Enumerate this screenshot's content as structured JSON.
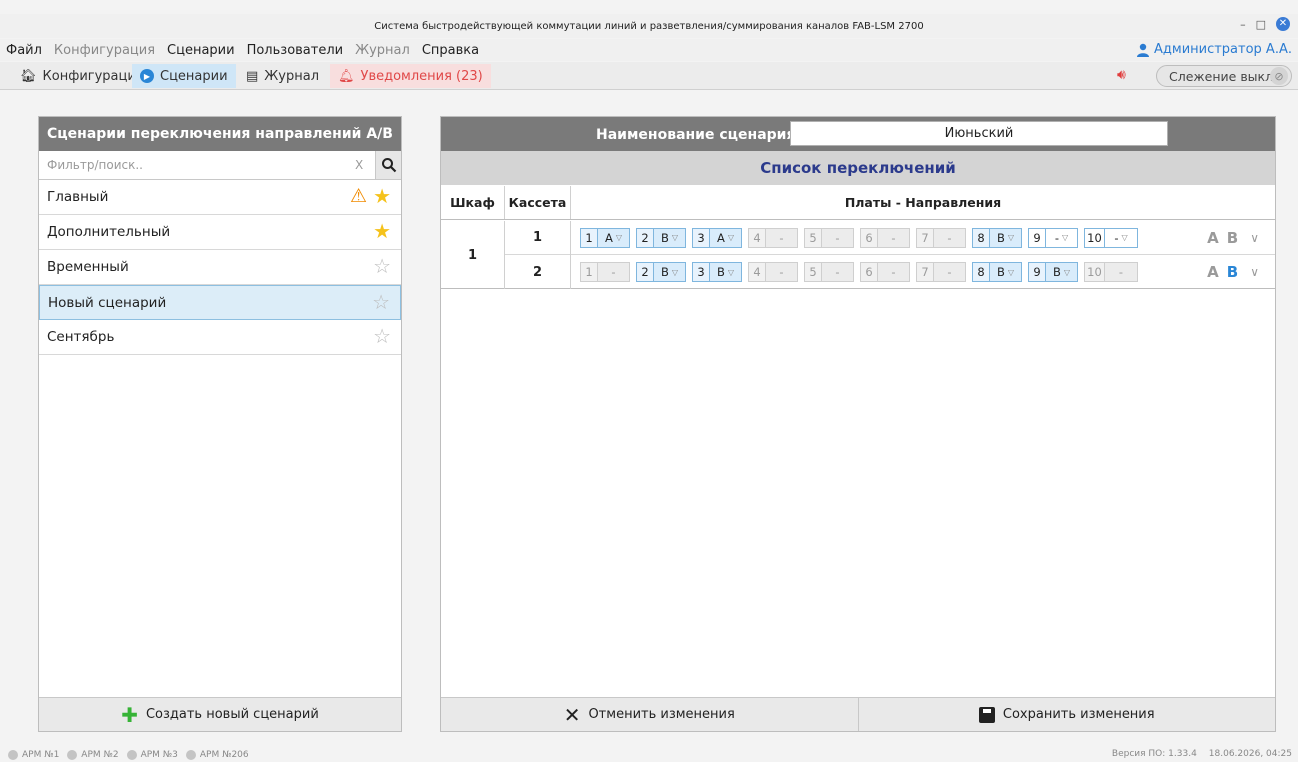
{
  "window": {
    "title": "Система быстродействующей коммутации линий и разветвления/суммирования каналов FAB-LSM 2700"
  },
  "menu": {
    "items": [
      "Файл",
      "Конфигурация",
      "Сценарии",
      "Пользователи",
      "Журнал",
      "Справка"
    ],
    "user": "Администратор А.А."
  },
  "tabs": {
    "config": "Конфигурация",
    "scenarios": "Сценарии",
    "journal": "Журнал",
    "notifications": "Уведомления (23)"
  },
  "tracking": {
    "label": "Слежение выкл."
  },
  "left": {
    "title": "Сценарии переключения направлений A/B",
    "filter_placeholder": "Фильтр/поиск..",
    "clear": "X",
    "scenarios": [
      {
        "name": "Главный",
        "warning": true,
        "starred": true
      },
      {
        "name": "Дополнительный",
        "warning": false,
        "starred": true
      },
      {
        "name": "Временный",
        "warning": false,
        "starred": false
      },
      {
        "name": "Новый сценарий",
        "warning": false,
        "starred": false,
        "selected": true
      },
      {
        "name": "Сентябрь",
        "warning": false,
        "starred": false
      }
    ],
    "create_button": "Создать новый сценарий"
  },
  "right": {
    "name_label": "Наименование сценария:",
    "name_value": "Июньский",
    "list_title": "Список переключений",
    "col_cabinet": "Шкаф",
    "col_cassette": "Кассета",
    "col_boards": "Платы - Направления",
    "cabinet": "1",
    "rows": [
      {
        "cassette": "1",
        "boards": [
          [
            "1",
            "A"
          ],
          [
            "2",
            "B"
          ],
          [
            "3",
            "A"
          ],
          [
            "4",
            "-"
          ],
          [
            "5",
            "-"
          ],
          [
            "6",
            "-"
          ],
          [
            "7",
            "-"
          ],
          [
            "8",
            "B"
          ],
          [
            "9",
            "-"
          ],
          [
            "10",
            "-"
          ]
        ]
      },
      {
        "cassette": "2",
        "boards": [
          [
            "1",
            "-"
          ],
          [
            "2",
            "B"
          ],
          [
            "3",
            "B"
          ],
          [
            "4",
            "-"
          ],
          [
            "5",
            "-"
          ],
          [
            "6",
            "-"
          ],
          [
            "7",
            "-"
          ],
          [
            "8",
            "B"
          ],
          [
            "9",
            "B"
          ],
          [
            "10",
            "-"
          ]
        ]
      }
    ],
    "letter_a": "A",
    "letter_b": "B",
    "cancel_button": "Отменить изменения",
    "save_button": "Сохранить изменения"
  },
  "status": {
    "apms": [
      "АРМ №1",
      "АРМ №2",
      "АРМ №3",
      "АРМ №206"
    ],
    "version": "Версия ПО: 1.33.4",
    "datetime": "18.06.2026, 04:25"
  }
}
